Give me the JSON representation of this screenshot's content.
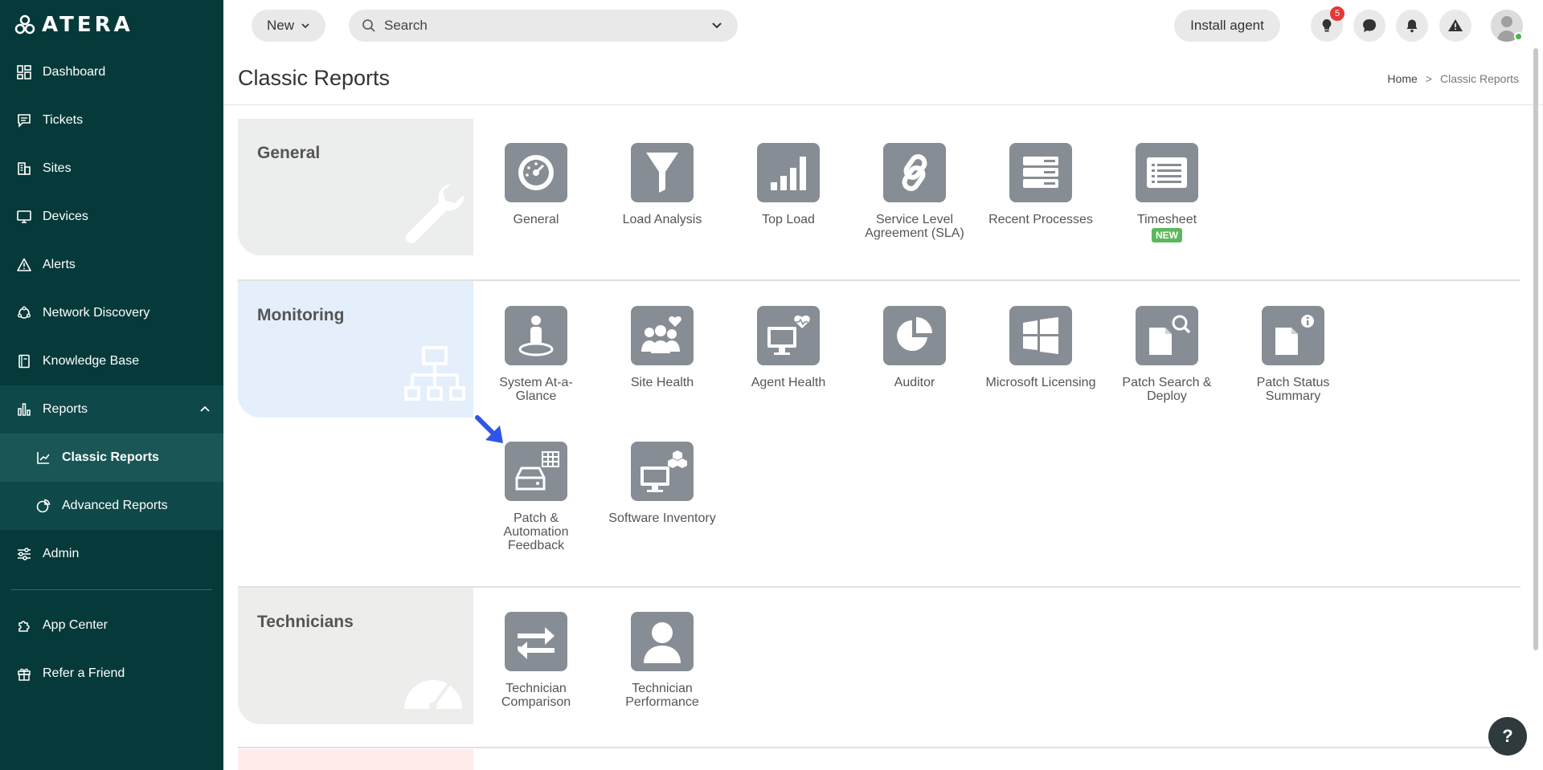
{
  "brand": {
    "logo_text": "ATERA"
  },
  "sidebar": {
    "items": [
      {
        "label": "Dashboard",
        "icon": "dashboard-icon"
      },
      {
        "label": "Tickets",
        "icon": "tickets-icon"
      },
      {
        "label": "Sites",
        "icon": "sites-icon"
      },
      {
        "label": "Devices",
        "icon": "devices-icon"
      },
      {
        "label": "Alerts",
        "icon": "alerts-icon"
      },
      {
        "label": "Network Discovery",
        "icon": "network-discovery-icon"
      },
      {
        "label": "Knowledge Base",
        "icon": "knowledge-base-icon"
      },
      {
        "label": "Reports",
        "icon": "reports-icon"
      }
    ],
    "reports_sub": [
      {
        "label": "Classic Reports",
        "icon": "classic-reports-icon",
        "active": true
      },
      {
        "label": "Advanced Reports",
        "icon": "advanced-reports-icon",
        "active": false
      }
    ],
    "admin": {
      "label": "Admin",
      "icon": "admin-icon"
    },
    "bottom": [
      {
        "label": "App Center",
        "icon": "app-center-icon"
      },
      {
        "label": "Refer a Friend",
        "icon": "gift-icon"
      }
    ]
  },
  "topbar": {
    "new_label": "New",
    "search_placeholder": "Search",
    "install_label": "Install agent",
    "notifications_count": "5"
  },
  "page": {
    "title": "Classic Reports",
    "breadcrumb": {
      "home": "Home",
      "separator": ">",
      "current": "Classic Reports"
    }
  },
  "sections": {
    "general": {
      "title": "General",
      "tiles": [
        {
          "label": "General",
          "icon": "speedometer-icon"
        },
        {
          "label": "Load Analysis",
          "icon": "funnel-icon"
        },
        {
          "label": "Top Load",
          "icon": "bar-chart-icon"
        },
        {
          "label": "Service Level Agreement (SLA)",
          "icon": "link-icon"
        },
        {
          "label": "Recent Processes",
          "icon": "server-icon"
        },
        {
          "label": "Timesheet",
          "icon": "timesheet-icon",
          "badge": "NEW"
        }
      ]
    },
    "monitoring": {
      "title": "Monitoring",
      "tiles": [
        {
          "label": "System At-a-Glance",
          "icon": "person-pin-icon"
        },
        {
          "label": "Site Health",
          "icon": "group-heart-icon"
        },
        {
          "label": "Agent Health",
          "icon": "monitor-heart-icon"
        },
        {
          "label": "Auditor",
          "icon": "pie-chart-icon"
        },
        {
          "label": "Microsoft Licensing",
          "icon": "windows-icon"
        },
        {
          "label": "Patch Search & Deploy",
          "icon": "document-search-icon"
        },
        {
          "label": "Patch Status Summary",
          "icon": "document-info-icon"
        },
        {
          "label": "Patch & Automation Feedback",
          "icon": "drive-table-icon"
        },
        {
          "label": "Software Inventory",
          "icon": "monitor-boxes-icon"
        }
      ]
    },
    "technicians": {
      "title": "Technicians",
      "tiles": [
        {
          "label": "Technician Comparison",
          "icon": "compare-arrows-icon"
        },
        {
          "label": "Technician Performance",
          "icon": "person-icon"
        }
      ]
    }
  },
  "colors": {
    "sidebar_bg": "#063a3a",
    "tile_bg": "#878d94",
    "general_bg": "#eceeed",
    "monitoring_bg": "#e4effb",
    "technicians_bg": "#edeeec",
    "new_badge": "#5cb85c",
    "notif_badge": "#e53935"
  },
  "help": {
    "label": "?"
  }
}
